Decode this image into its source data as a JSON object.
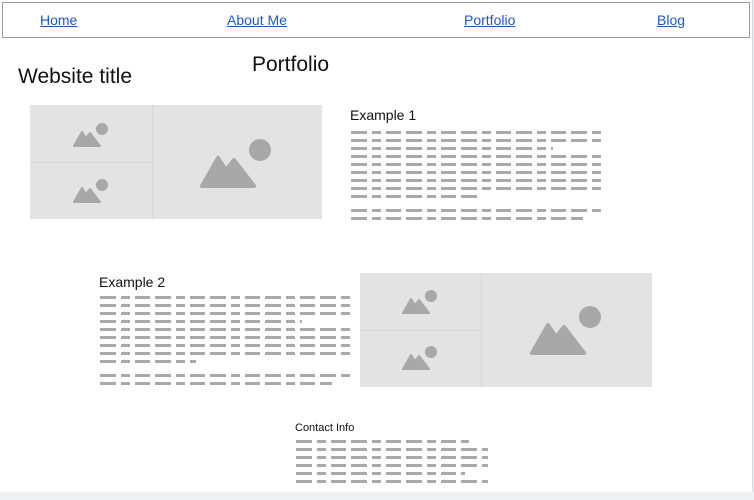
{
  "nav": {
    "items": [
      {
        "label": "Home"
      },
      {
        "label": "About Me"
      },
      {
        "label": "Portfolio"
      },
      {
        "label": "Blog"
      }
    ]
  },
  "header": {
    "site_title": "Website title",
    "page_title": "Portfolio"
  },
  "projects": [
    {
      "title": "Example 1"
    },
    {
      "title": "Example 2"
    }
  ],
  "contact": {
    "title": "Contact Info"
  },
  "icons": [
    "image-placeholder-icon"
  ],
  "colors": {
    "link": "#1f57c3",
    "placeholder_bg": "#e3e3e3",
    "placeholder_icon": "#a8a8a8"
  }
}
